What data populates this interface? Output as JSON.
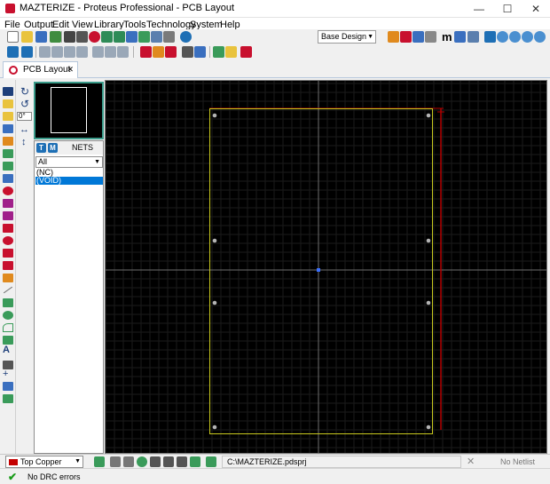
{
  "window": {
    "title": "MAZTERIZE - Proteus Professional - PCB Layout",
    "minimize_glyph": "—",
    "maximize_glyph": "☐",
    "close_glyph": "✕"
  },
  "menu": [
    "File",
    "Output",
    "Edit",
    "View",
    "Library",
    "Tools",
    "Technology",
    "System",
    "Help"
  ],
  "toolbar": {
    "design_select": "Base Design",
    "zoom_letter": "m"
  },
  "tab": {
    "label": "PCB Layout"
  },
  "rotation": {
    "angle": "0°"
  },
  "nets_panel": {
    "badge_t": "T",
    "badge_m": "M",
    "title": "NETS",
    "filter": "All",
    "items": [
      "(NC)",
      "(VOID)"
    ],
    "selected_index": 1
  },
  "bottom": {
    "layer": "Top Copper",
    "layer_color": "#c40000",
    "project_path": "C:\\MAZTERIZE.pdsprj",
    "netlist_status": "No Netlist",
    "netlist_icon": "✕"
  },
  "status": {
    "message": "No DRC errors",
    "icon": "✔"
  },
  "colors": {
    "board_outline": "#c8c81e",
    "canvas_bg": "#000000",
    "grid": "#1b1b1b",
    "origin": "#6e6e6e",
    "dimension": "#b40000"
  }
}
